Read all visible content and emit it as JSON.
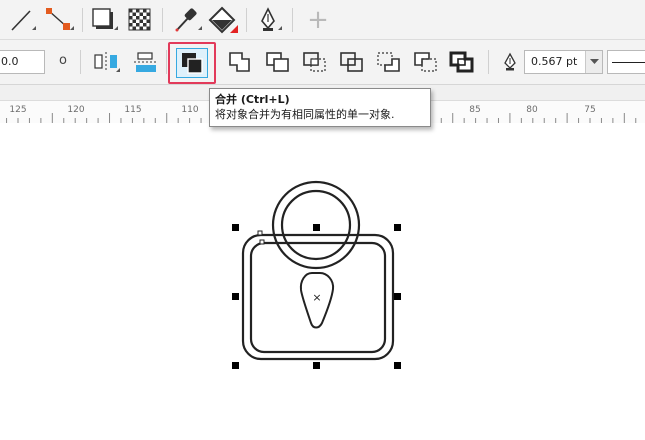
{
  "toolbar_top": {
    "tools": [
      {
        "name": "line-tool",
        "icon": "line-icon"
      },
      {
        "name": "node-tool",
        "icon": "node-line-icon"
      },
      {
        "name": "drop-shadow-tool",
        "icon": "drop-shadow-icon"
      },
      {
        "name": "transparency-tool",
        "icon": "checkerboard-icon"
      },
      {
        "name": "eyedropper-tool",
        "icon": "eyedropper-icon"
      },
      {
        "name": "fill-tool",
        "icon": "paint-bucket-icon"
      },
      {
        "name": "pen-tool",
        "icon": "pen-nib-icon"
      },
      {
        "name": "add-tool",
        "icon": "plus-icon",
        "label": "+"
      }
    ]
  },
  "property_bar": {
    "position_value": "0.0",
    "circle_label": "o",
    "buttons": [
      {
        "name": "mirror-button",
        "icon": "mirror-icon"
      },
      {
        "name": "align-button",
        "icon": "align-icon"
      },
      {
        "name": "combine-button",
        "icon": "combine-icon",
        "active": true
      },
      {
        "name": "weld-button",
        "icon": "weld-icon"
      },
      {
        "name": "trim-button",
        "icon": "trim-icon"
      },
      {
        "name": "intersect-button",
        "icon": "intersect-icon"
      },
      {
        "name": "simplify-button",
        "icon": "simplify-icon"
      },
      {
        "name": "front-minus-back-button",
        "icon": "front-minus-back-icon"
      },
      {
        "name": "back-minus-front-button",
        "icon": "back-minus-front-icon"
      },
      {
        "name": "boundary-button",
        "icon": "boundary-icon"
      }
    ],
    "outline_width": "0.567 pt",
    "accent_color": "#e23a5a",
    "highlight_color": "#36a9e1"
  },
  "ruler": {
    "labels": [
      "125",
      "120",
      "115",
      "110",
      "85",
      "80",
      "75"
    ]
  },
  "tooltip": {
    "title": "合并 (Ctrl+L)",
    "description": "将对象合并为有相同属性的单一对象."
  },
  "canvas": {
    "center_mark": "×"
  }
}
